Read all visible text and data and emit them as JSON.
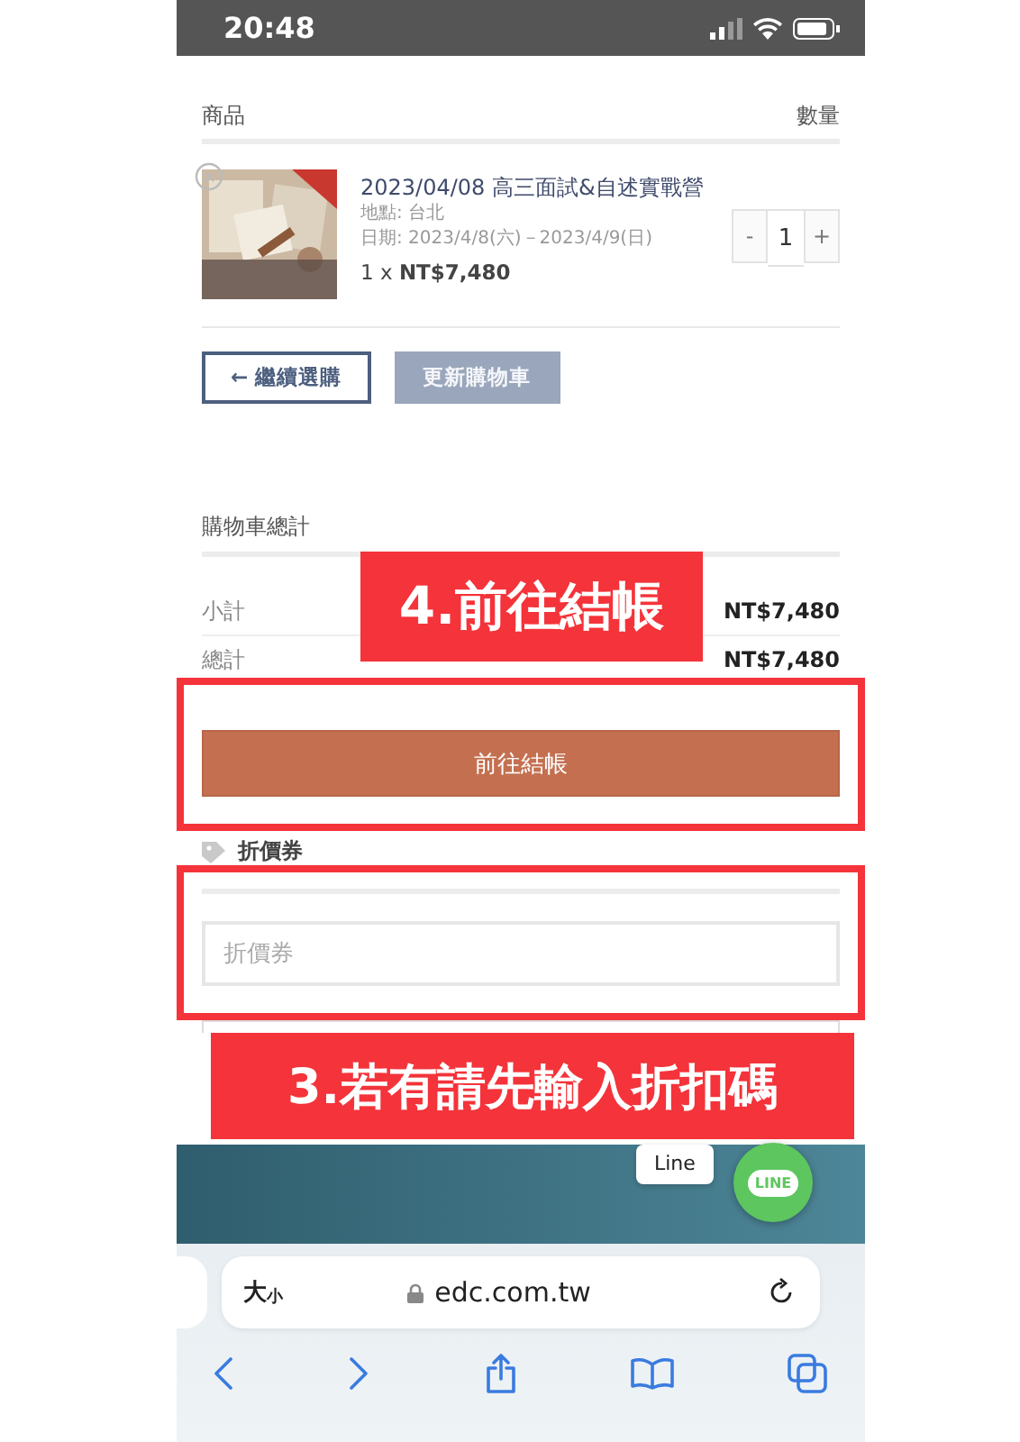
{
  "status_bar": {
    "time": "20:48"
  },
  "cart": {
    "columns": [
      "商品",
      "數量"
    ],
    "items": [
      {
        "title": "2023/04/08 高三面試&自述實戰營",
        "location": "地點: 台北",
        "date": "日期: 2023/4/8(六)－2023/4/9(日)",
        "line_total": "1 x **NT$7,480**",
        "quantity": "1",
        "decrement": "-",
        "increment": "+"
      }
    ],
    "buttons": [
      {
        "label": "← 繼續選購",
        "kind": "outline"
      },
      {
        "label": "更新購物車",
        "kind": "muted"
      }
    ]
  },
  "totals": {
    "title": "購物車總計",
    "rows": [
      {
        "label": "小計",
        "value": "NT$7,480"
      },
      {
        "label": "總計",
        "value": "NT$7,480"
      }
    ],
    "checkout": "前往結帳"
  },
  "coupon": {
    "title": "折價券",
    "placeholder": "折價券"
  },
  "chat": {
    "tooltip": "Line",
    "badge": "LINE"
  },
  "browser": {
    "text_size": "大$_{小}$",
    "url": "edc.com.tw"
  },
  "annotations": [
    {
      "label": "4.前往結帳"
    },
    {
      "label": "3.若有請先輸入折扣碼"
    }
  ]
}
